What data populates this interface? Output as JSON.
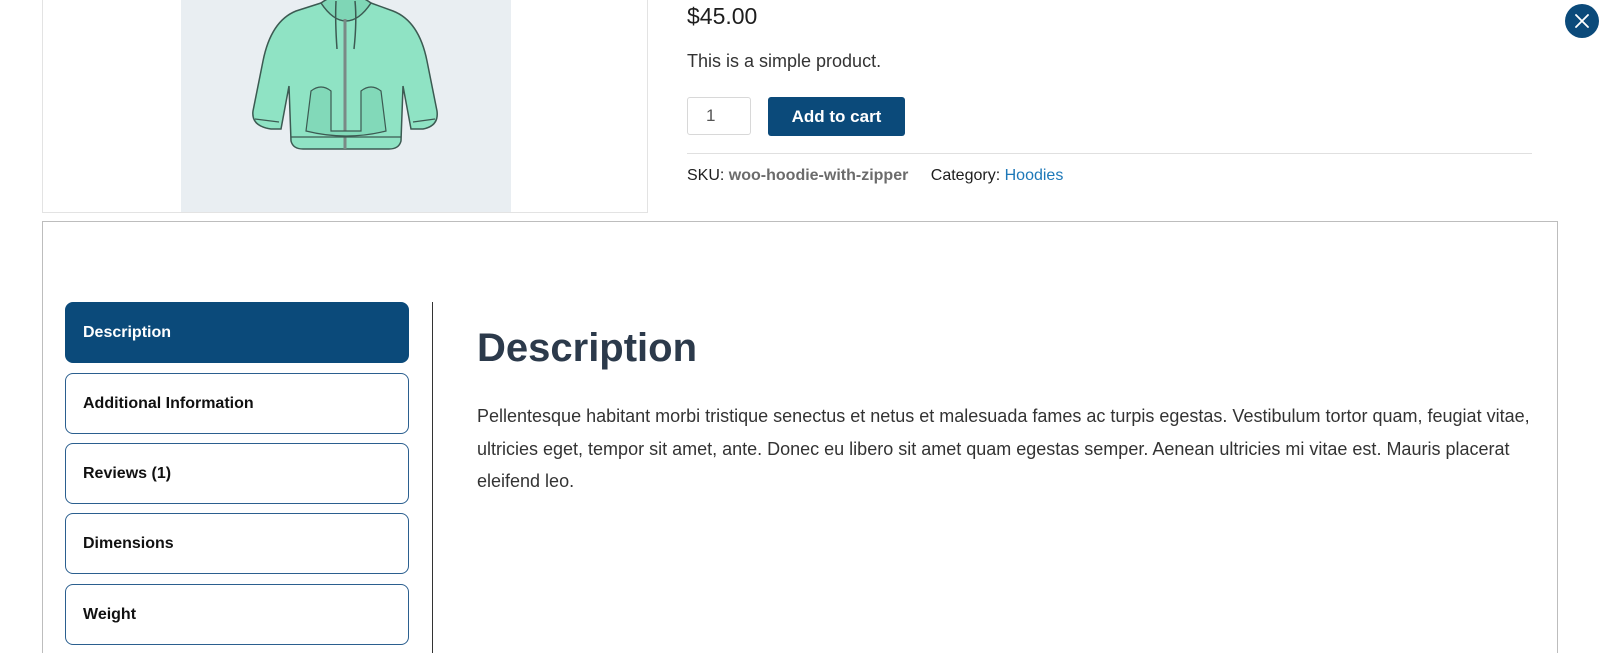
{
  "product": {
    "price": "$45.00",
    "short_description": "This is a simple product.",
    "quantity": "1",
    "add_to_cart_label": "Add to cart",
    "sku_label": "SKU:",
    "sku_value": "woo-hoodie-with-zipper",
    "category_label": "Category:",
    "category_value": "Hoodies",
    "image_alt": "hoodie-with-zipper"
  },
  "tabs": [
    {
      "label": "Description",
      "active": true
    },
    {
      "label": "Additional Information",
      "active": false
    },
    {
      "label": "Reviews (1)",
      "active": false
    },
    {
      "label": "Dimensions",
      "active": false
    },
    {
      "label": "Weight",
      "active": false
    }
  ],
  "panel": {
    "heading": "Description",
    "text": "Pellentesque habitant morbi tristique senectus et netus et malesuada fames ac turpis egestas. Vestibulum tortor quam, feugiat vitae, ultricies eget, tempor sit amet, ante. Donec eu libero sit amet quam egestas semper. Aenean ultricies mi vitae est. Mauris placerat eleifend leo."
  },
  "icons": {
    "close": "close-icon",
    "hoodie": "hoodie-image"
  },
  "colors": {
    "accent": "#0b4a7a",
    "link": "#1d78b8",
    "image_bg": "#e9eef2",
    "hoodie": "#8fe3c4"
  }
}
